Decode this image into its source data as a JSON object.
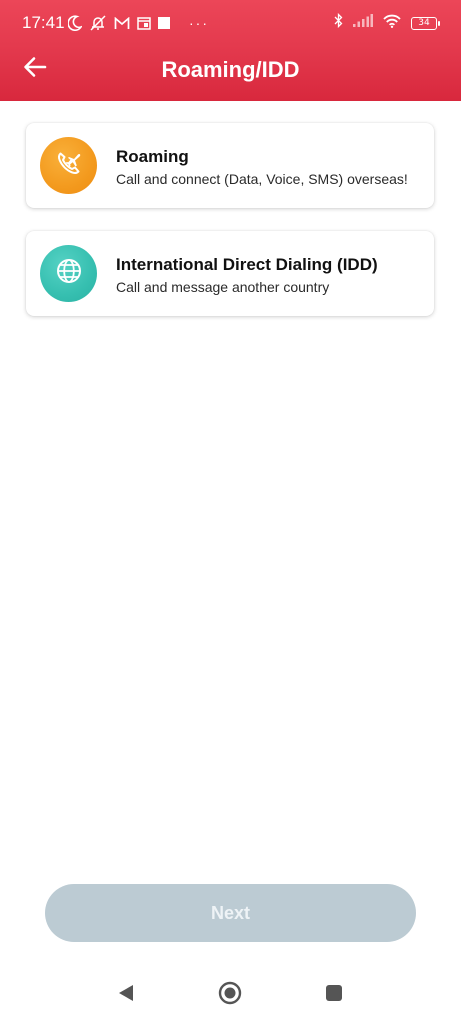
{
  "status_bar": {
    "time": "17:41",
    "battery": "34",
    "icons": [
      "moon-icon",
      "notification-off-icon",
      "gmail-icon",
      "calendar-icon",
      "square-icon",
      "more-dots-icon",
      "bluetooth-icon",
      "signal-icon",
      "wifi-icon",
      "battery-icon"
    ],
    "dots": "···"
  },
  "app_bar": {
    "title": "Roaming/IDD",
    "back_icon": "arrow-left-icon"
  },
  "options": [
    {
      "title": "Roaming",
      "subtitle": "Call and connect (Data, Voice, SMS) overseas!",
      "icon": "phone-airplane-icon",
      "icon_color": "#f39a1e"
    },
    {
      "title": "International Direct Dialing (IDD)",
      "subtitle": "Call and message another country",
      "icon": "globe-icon",
      "icon_color": "#36bfb0"
    }
  ],
  "next_button": {
    "label": "Next",
    "enabled": false
  },
  "colors": {
    "header": "#e43a4e",
    "button_disabled": "#bccbd3"
  },
  "nav_bar": {
    "icons": [
      "nav-back-icon",
      "nav-home-icon",
      "nav-recents-icon"
    ]
  }
}
